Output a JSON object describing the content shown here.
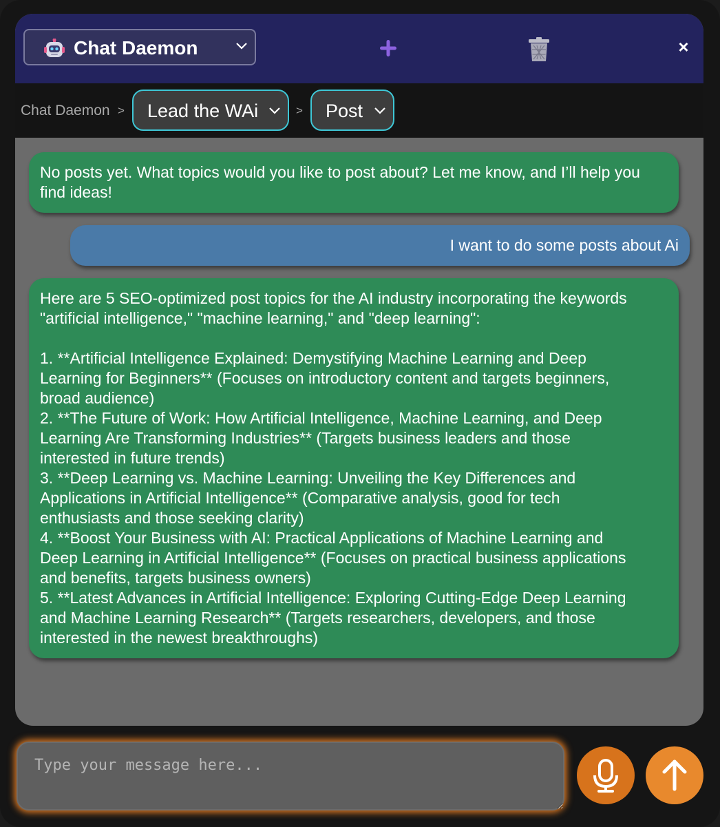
{
  "header": {
    "bot_name": "Chat Daemon",
    "icons": {
      "bot": "robot-icon",
      "new_chat": "plus-icon",
      "delete": "trash-icon",
      "close": "close-icon"
    },
    "close_label": "×"
  },
  "breadcrumb": {
    "root": "Chat Daemon",
    "separator": ">",
    "project": "Lead the WAi",
    "section": "Post"
  },
  "messages": [
    {
      "role": "bot",
      "lines": [
        "No posts yet. What topics would you like to post about? Let me know, and I’ll help you",
        "find ideas!"
      ]
    },
    {
      "role": "user",
      "lines": [
        "I want to do some posts about Ai"
      ]
    },
    {
      "role": "bot",
      "lines": [
        "Here are 5 SEO-optimized post topics for the AI industry incorporating the keywords",
        "\"artificial intelligence,\" \"machine learning,\" and \"deep learning\":",
        "",
        "1. **Artificial Intelligence Explained: Demystifying Machine Learning and Deep",
        "Learning for Beginners** (Focuses on introductory content and targets beginners,",
        "broad audience)",
        "2. **The Future of Work: How Artificial Intelligence, Machine Learning, and Deep",
        "Learning Are Transforming Industries** (Targets business leaders and those",
        "interested in future trends)",
        "3. **Deep Learning vs. Machine Learning: Unveiling the Key Differences and",
        "Applications in Artificial Intelligence** (Comparative analysis, good for tech",
        "enthusiasts and those seeking clarity)",
        "4. **Boost Your Business with AI: Practical Applications of Machine Learning and",
        "Deep Learning in Artificial Intelligence** (Focuses on practical business applications",
        "and benefits, targets business owners)",
        "5. **Latest Advances in Artificial Intelligence: Exploring Cutting-Edge Deep Learning",
        "and Machine Learning Research** (Targets researchers, developers, and those",
        "interested in the newest breakthroughs)"
      ]
    }
  ],
  "composer": {
    "placeholder": "Type your message here...",
    "value": "",
    "mic_icon": "microphone-icon",
    "send_icon": "arrow-up-icon"
  },
  "colors": {
    "header_bg": "#23235e",
    "bot_bubble": "#2e8b57",
    "user_bubble": "#4a7aa8",
    "accent_orange": "#e07a22",
    "pill_border": "#3ec7d6"
  }
}
